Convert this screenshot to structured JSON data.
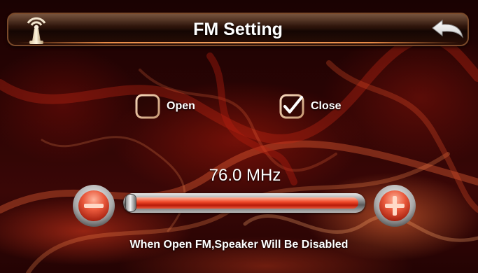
{
  "header": {
    "title": "FM Setting",
    "left_icon": "antenna-icon",
    "right_icon": "back-arrow-icon"
  },
  "options": [
    {
      "label": "Open",
      "checked": false
    },
    {
      "label": "Close",
      "checked": true
    }
  ],
  "frequency": {
    "readout": "76.0 MHz",
    "level_fraction": 0.0,
    "decrease_icon": "minus-icon",
    "increase_icon": "plus-icon"
  },
  "footer": {
    "warning": "When Open FM,Speaker Will Be Disabled"
  },
  "colors": {
    "accent": "#e8573a",
    "checkmark": "#ffffff",
    "title_text": "#ffffff"
  }
}
